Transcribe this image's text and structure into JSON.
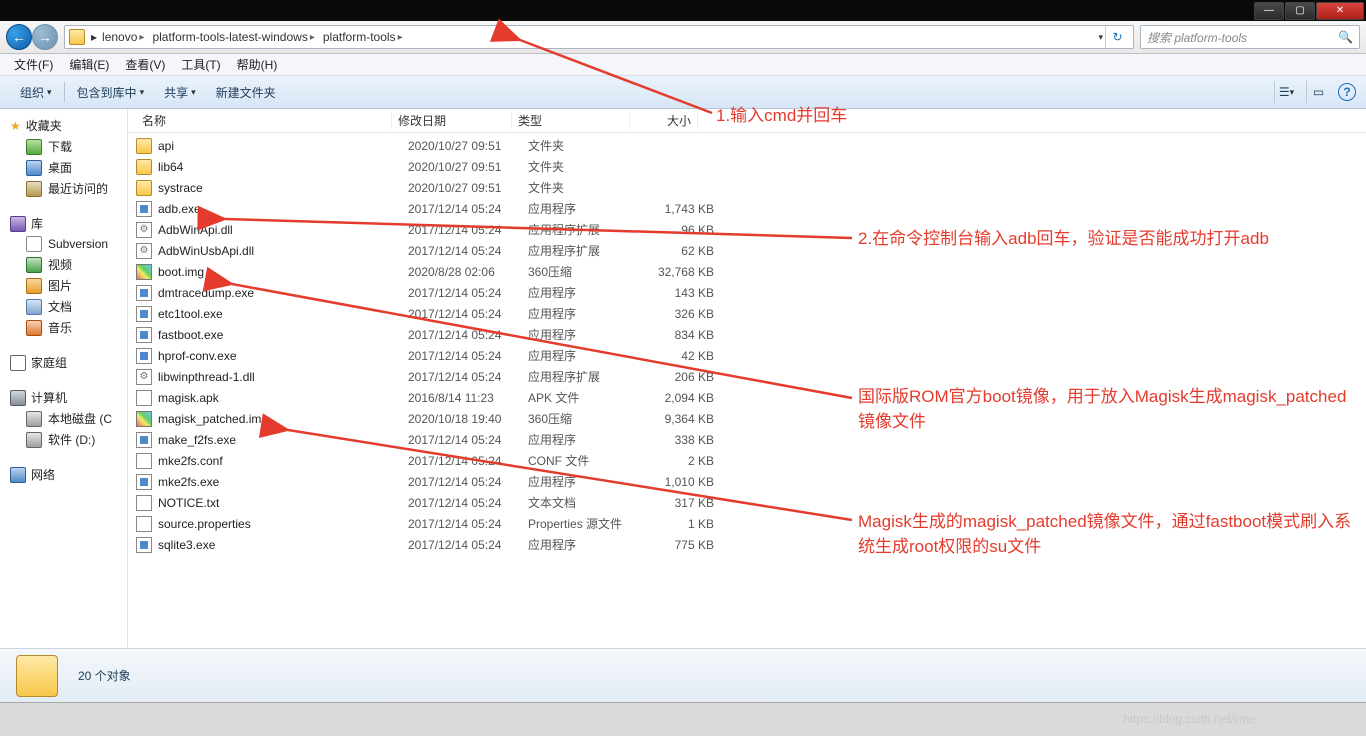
{
  "window": {
    "min": "—",
    "max": "▢",
    "close": "✕"
  },
  "breadcrumb": {
    "segments": [
      "lenovo",
      "platform-tools-latest-windows",
      "platform-tools"
    ],
    "refresh_icon": "↻"
  },
  "search": {
    "placeholder": "搜索 platform-tools",
    "icon": "🔍"
  },
  "menu": {
    "file": "文件(F)",
    "edit": "编辑(E)",
    "view": "查看(V)",
    "tools": "工具(T)",
    "help": "帮助(H)"
  },
  "cmdbar": {
    "organize": "组织",
    "include": "包含到库中",
    "share": "共享",
    "newfolder": "新建文件夹",
    "view_icon": "☰",
    "preview_icon": "▭",
    "help_icon": "?"
  },
  "sidebar": {
    "favorites": {
      "title": "收藏夹",
      "items": [
        "下载",
        "桌面",
        "最近访问的"
      ]
    },
    "libraries": {
      "title": "库",
      "items": [
        "Subversion",
        "视频",
        "图片",
        "文档",
        "音乐"
      ]
    },
    "homegroup": {
      "title": "家庭组"
    },
    "computer": {
      "title": "计算机",
      "drives": [
        "本地磁盘 (C",
        "软件 (D:)"
      ]
    },
    "network": {
      "title": "网络"
    }
  },
  "columns": {
    "name": "名称",
    "date": "修改日期",
    "type": "类型",
    "size": "大小"
  },
  "files": [
    {
      "icon": "folder",
      "name": "api",
      "date": "2020/10/27 09:51",
      "type": "文件夹",
      "size": ""
    },
    {
      "icon": "folder",
      "name": "lib64",
      "date": "2020/10/27 09:51",
      "type": "文件夹",
      "size": ""
    },
    {
      "icon": "folder",
      "name": "systrace",
      "date": "2020/10/27 09:51",
      "type": "文件夹",
      "size": ""
    },
    {
      "icon": "exe",
      "name": "adb.exe",
      "date": "2017/12/14 05:24",
      "type": "应用程序",
      "size": "1,743 KB"
    },
    {
      "icon": "dll",
      "name": "AdbWinApi.dll",
      "date": "2017/12/14 05:24",
      "type": "应用程序扩展",
      "size": "96 KB"
    },
    {
      "icon": "dll",
      "name": "AdbWinUsbApi.dll",
      "date": "2017/12/14 05:24",
      "type": "应用程序扩展",
      "size": "62 KB"
    },
    {
      "icon": "img",
      "name": "boot.img",
      "date": "2020/8/28 02:06",
      "type": "360压缩",
      "size": "32,768 KB"
    },
    {
      "icon": "exe",
      "name": "dmtracedump.exe",
      "date": "2017/12/14 05:24",
      "type": "应用程序",
      "size": "143 KB"
    },
    {
      "icon": "exe",
      "name": "etc1tool.exe",
      "date": "2017/12/14 05:24",
      "type": "应用程序",
      "size": "326 KB"
    },
    {
      "icon": "exe",
      "name": "fastboot.exe",
      "date": "2017/12/14 05:24",
      "type": "应用程序",
      "size": "834 KB"
    },
    {
      "icon": "exe",
      "name": "hprof-conv.exe",
      "date": "2017/12/14 05:24",
      "type": "应用程序",
      "size": "42 KB"
    },
    {
      "icon": "dll",
      "name": "libwinpthread-1.dll",
      "date": "2017/12/14 05:24",
      "type": "应用程序扩展",
      "size": "206 KB"
    },
    {
      "icon": "apk",
      "name": "magisk.apk",
      "date": "2016/8/14 11:23",
      "type": "APK 文件",
      "size": "2,094 KB"
    },
    {
      "icon": "img",
      "name": "magisk_patched.img",
      "date": "2020/10/18 19:40",
      "type": "360压缩",
      "size": "9,364 KB"
    },
    {
      "icon": "exe",
      "name": "make_f2fs.exe",
      "date": "2017/12/14 05:24",
      "type": "应用程序",
      "size": "338 KB"
    },
    {
      "icon": "conf",
      "name": "mke2fs.conf",
      "date": "2017/12/14 05:24",
      "type": "CONF 文件",
      "size": "2 KB"
    },
    {
      "icon": "exe",
      "name": "mke2fs.exe",
      "date": "2017/12/14 05:24",
      "type": "应用程序",
      "size": "1,010 KB"
    },
    {
      "icon": "txt",
      "name": "NOTICE.txt",
      "date": "2017/12/14 05:24",
      "type": "文本文档",
      "size": "317 KB"
    },
    {
      "icon": "prop",
      "name": "source.properties",
      "date": "2017/12/14 05:24",
      "type": "Properties 源文件",
      "size": "1 KB"
    },
    {
      "icon": "exe",
      "name": "sqlite3.exe",
      "date": "2017/12/14 05:24",
      "type": "应用程序",
      "size": "775 KB"
    }
  ],
  "status": {
    "count_text": "20 个对象"
  },
  "annotations": {
    "a1": "1.输入cmd并回车",
    "a2": "2.在命令控制台输入adb回车，验证是否能成功打开adb",
    "a3": "国际版ROM官方boot镜像，用于放入Magisk生成magisk_patched镜像文件",
    "a4": "Magisk生成的magisk_patched镜像文件，通过fastboot模式刷入系统生成root权限的su文件"
  },
  "watermark": "https://blog.csdn.net/iime"
}
